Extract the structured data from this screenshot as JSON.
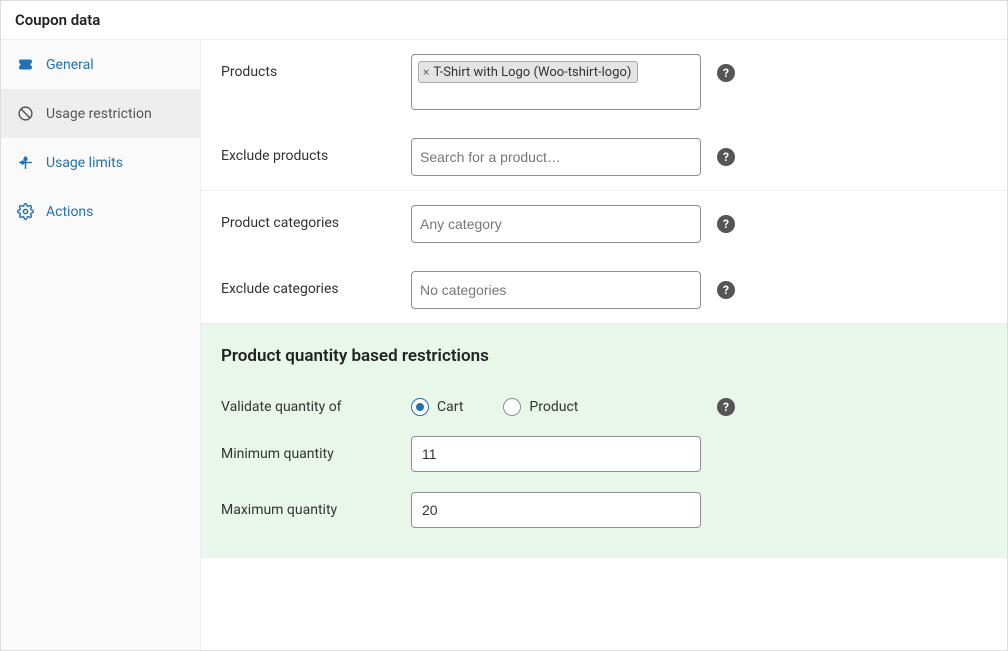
{
  "panel_title": "Coupon data",
  "sidebar": {
    "items": [
      {
        "label": "General",
        "icon": "ticket-icon"
      },
      {
        "label": "Usage restriction",
        "icon": "block-icon"
      },
      {
        "label": "Usage limits",
        "icon": "sliders-icon"
      },
      {
        "label": "Actions",
        "icon": "gear-icon"
      }
    ],
    "active_index": 1
  },
  "sections": {
    "products": {
      "label": "Products",
      "selected": [
        {
          "text": "T-Shirt with Logo (Woo-tshirt-logo)"
        }
      ]
    },
    "exclude_products": {
      "label": "Exclude products",
      "placeholder": "Search for a product…"
    },
    "product_categories": {
      "label": "Product categories",
      "placeholder": "Any category"
    },
    "exclude_categories": {
      "label": "Exclude categories",
      "placeholder": "No categories"
    },
    "quantity": {
      "heading": "Product quantity based restrictions",
      "validate_label": "Validate quantity of",
      "options": {
        "cart": "Cart",
        "product": "Product"
      },
      "selected": "cart",
      "min_label": "Minimum quantity",
      "min_value": "11",
      "max_label": "Maximum quantity",
      "max_value": "20"
    }
  },
  "glyphs": {
    "help": "?"
  }
}
